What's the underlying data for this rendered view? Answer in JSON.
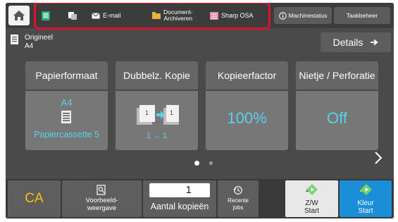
{
  "colors": {
    "screen_bg": "#4a4a4a",
    "highlight": "#e0112b",
    "accent_teal": "#5ad0ea",
    "ca_yellow": "#f5c400",
    "color_start": "#1a8ed6"
  },
  "topbar": {
    "home_icon": "home-icon",
    "tabs": [
      {
        "icon": "copy-icon",
        "label": ""
      },
      {
        "icon": "scan-icon",
        "label": ""
      },
      {
        "icon": "email-icon",
        "label": "E-mail"
      },
      {
        "icon": "document-filing-icon",
        "label_line1": "Document-",
        "label_line2": "Archiveren"
      },
      {
        "icon": "sharp-osa-icon",
        "label": "Sharp OSA"
      }
    ],
    "machine_status": "Machinestatus",
    "job_status": "Taakbeheer"
  },
  "original": {
    "title": "Origineel",
    "size": "A4",
    "details": "Details"
  },
  "cards": {
    "paper": {
      "title": "Papierformaat",
      "size": "A4",
      "tray": "Papiercassette 5"
    },
    "duplex": {
      "title": "Dubbelz. Kopie",
      "value": "1 → 1"
    },
    "ratio": {
      "title": "Kopieerfactor",
      "value": "100%"
    },
    "staple": {
      "title": "Nietje / Perforatie",
      "value": "Off"
    }
  },
  "pager": {
    "current_page": 1,
    "total_pages": 2
  },
  "bottom": {
    "ca": "CA",
    "preview_line1": "Voorbeeld-",
    "preview_line2": "weergave",
    "copies_value": "1",
    "copies_label": "Aantal kopieën",
    "jobs_line1": "Recente",
    "jobs_line2": "jobs",
    "bw_line1": "Z/W",
    "bw_line2": "Start",
    "color_line1": "Kleur",
    "color_line2": "Start"
  }
}
